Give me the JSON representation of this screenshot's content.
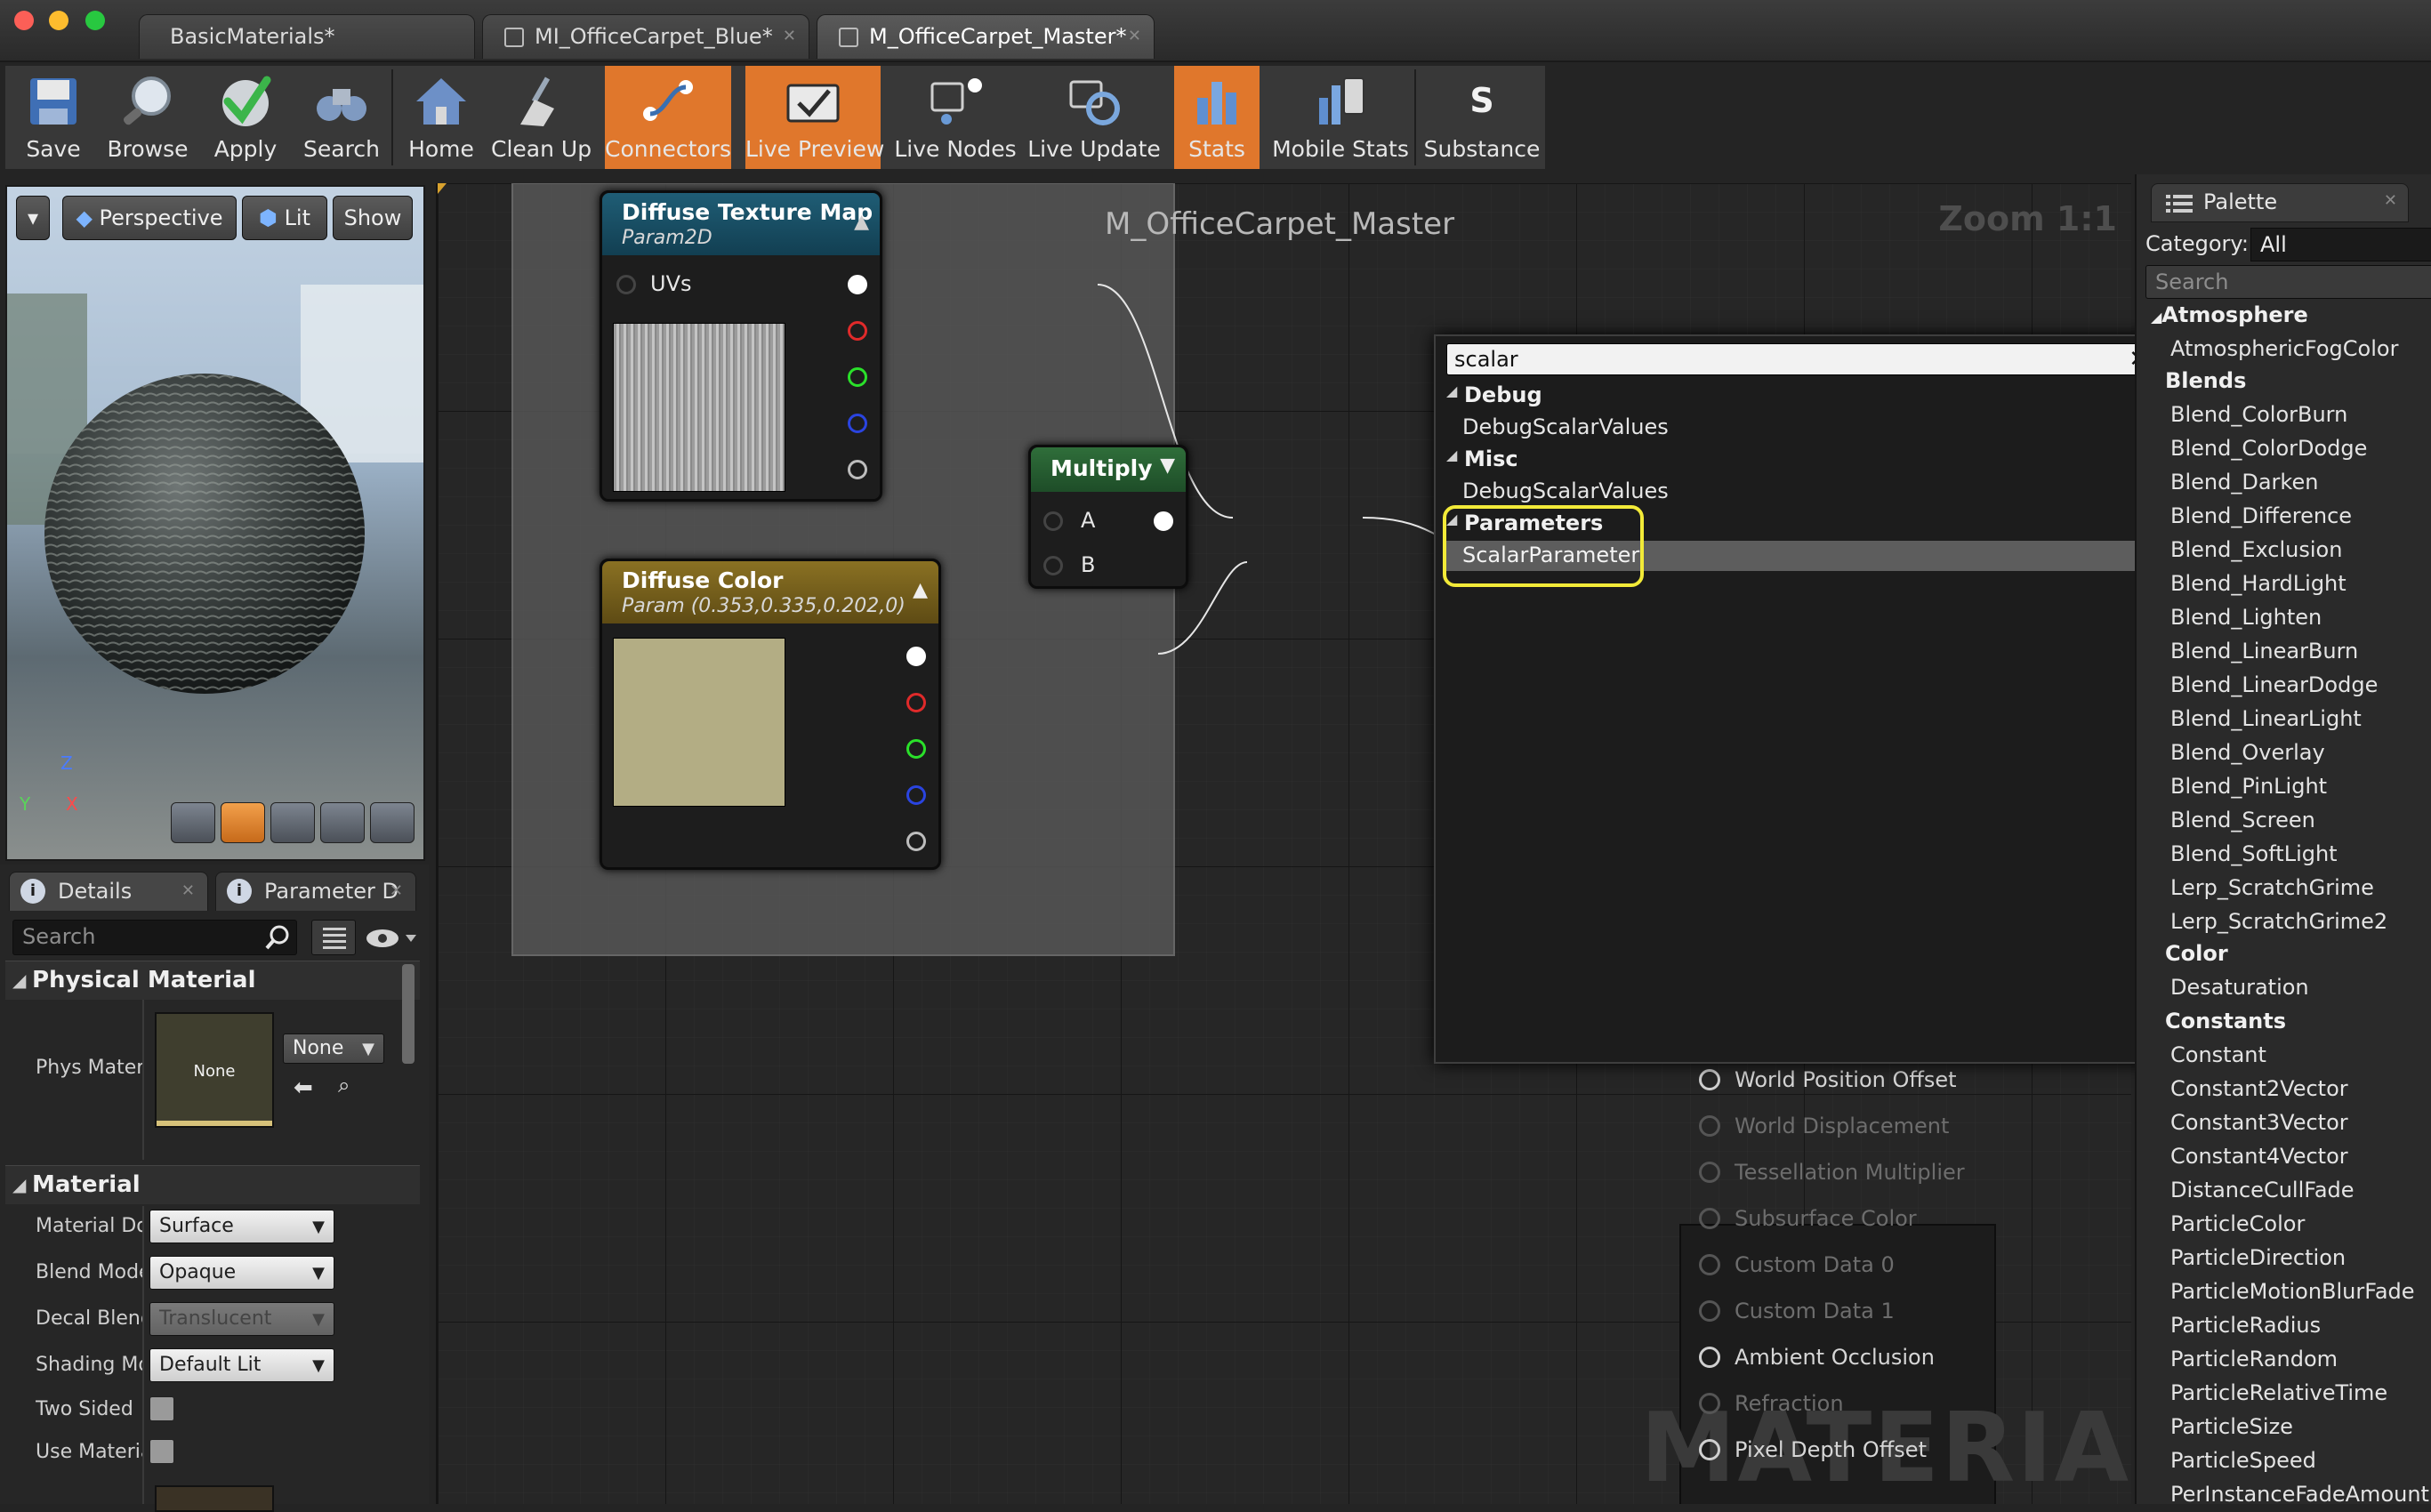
{
  "tabs": [
    {
      "label": "BasicMaterials*"
    },
    {
      "label": "MI_OfficeCarpet_Blue*"
    },
    {
      "label": "M_OfficeCarpet_Master*"
    }
  ],
  "toolbar": {
    "save": "Save",
    "browse": "Browse",
    "apply": "Apply",
    "search": "Search",
    "home": "Home",
    "cleanup": "Clean Up",
    "connectors": "Connectors",
    "live_preview": "Live Preview",
    "live_nodes": "Live Nodes",
    "live_update": "Live Update",
    "stats": "Stats",
    "mobile_stats": "Mobile Stats",
    "substance": "Substance"
  },
  "viewport": {
    "perspective": "Perspective",
    "lit": "Lit",
    "show": "Show",
    "axis_z": "Z",
    "axis_y": "Y",
    "axis_x": "X"
  },
  "details": {
    "tab_details": "Details",
    "tab_parameter": "Parameter D",
    "search_placeholder": "Search",
    "physical_material": "Physical Material",
    "phys_label": "Phys Materi",
    "phys_thumb": "None",
    "phys_value": "None",
    "material": "Material",
    "rows": [
      {
        "label": "Material Doi",
        "value": "Surface"
      },
      {
        "label": "Blend Mode",
        "value": "Opaque"
      },
      {
        "label": "Decal Blend",
        "value": "Translucent"
      },
      {
        "label": "Shading Mo",
        "value": "Default Lit"
      },
      {
        "label": "Two Sided"
      },
      {
        "label": "Use Materia"
      }
    ]
  },
  "graph": {
    "title": "M_OfficeCarpet_Master",
    "zoom": "Zoom 1:1",
    "watermark": "MATERIAL",
    "tex_node": {
      "title": "Diffuse Texture Map",
      "sub": "Param2D",
      "uvs": "UVs"
    },
    "color_node": {
      "title": "Diffuse Color",
      "sub": "Param (0.353,0.335,0.202,0)"
    },
    "multiply_node": {
      "title": "Multiply",
      "a": "A",
      "b": "B"
    },
    "outputs": [
      {
        "label": "World Position Offset",
        "active": true
      },
      {
        "label": "World Displacement",
        "active": false
      },
      {
        "label": "Tessellation Multiplier",
        "active": false
      },
      {
        "label": "Subsurface Color",
        "active": false
      },
      {
        "label": "Custom Data 0",
        "active": false
      },
      {
        "label": "Custom Data 1",
        "active": false
      },
      {
        "label": "Ambient Occlusion",
        "active": true
      },
      {
        "label": "Refraction",
        "active": false
      },
      {
        "label": "Pixel Depth Offset",
        "active": true
      }
    ]
  },
  "popup": {
    "query": "scalar",
    "cat_debug": "Debug",
    "item_debug": "DebugScalarValues",
    "cat_misc": "Misc",
    "item_misc": "DebugScalarValues",
    "cat_params": "Parameters",
    "item_params": "ScalarParameter"
  },
  "palette": {
    "title": "Palette",
    "category_label": "Category:",
    "category_value": "All",
    "search_placeholder": "Search",
    "cat_atmosphere": "Atmosphere",
    "item_atm": "AtmosphericFogColor",
    "cat_blends": "Blends",
    "blends": [
      "Blend_ColorBurn",
      "Blend_ColorDodge",
      "Blend_Darken",
      "Blend_Difference",
      "Blend_Exclusion",
      "Blend_HardLight",
      "Blend_Lighten",
      "Blend_LinearBurn",
      "Blend_LinearDodge",
      "Blend_LinearLight",
      "Blend_Overlay",
      "Blend_PinLight",
      "Blend_Screen",
      "Blend_SoftLight",
      "Lerp_ScratchGrime",
      "Lerp_ScratchGrime2"
    ],
    "cat_color": "Color",
    "item_color": "Desaturation",
    "cat_constants": "Constants",
    "constants": [
      "Constant",
      "Constant2Vector",
      "Constant3Vector",
      "Constant4Vector",
      "DistanceCullFade",
      "ParticleColor",
      "ParticleDirection",
      "ParticleMotionBlurFade",
      "ParticleRadius",
      "ParticleRandom",
      "ParticleRelativeTime",
      "ParticleSize",
      "ParticleSpeed",
      "PerInstanceFadeAmount"
    ]
  }
}
